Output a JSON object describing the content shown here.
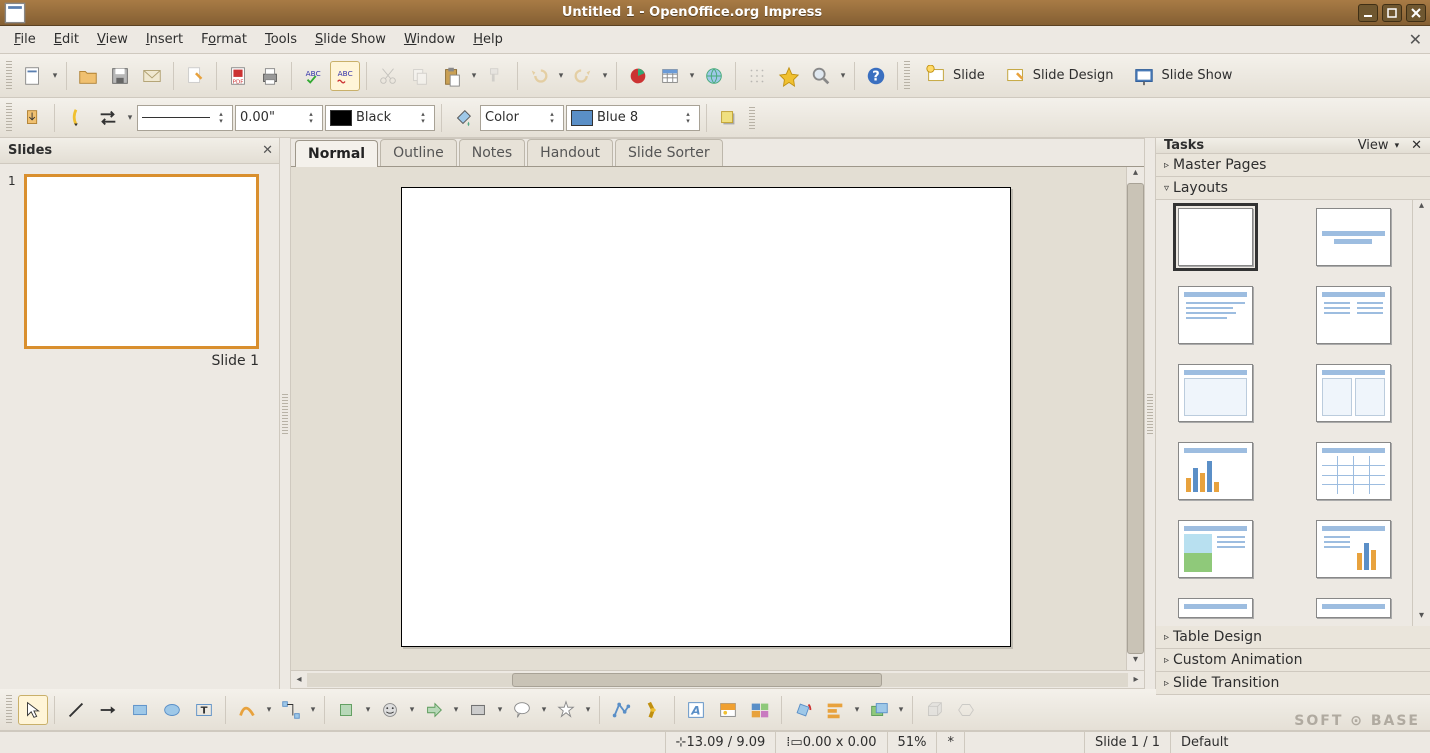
{
  "titlebar": {
    "title": "Untitled 1 - OpenOffice.org Impress"
  },
  "menubar": {
    "items": [
      "File",
      "Edit",
      "View",
      "Insert",
      "Format",
      "Tools",
      "Slide Show",
      "Window",
      "Help"
    ]
  },
  "toolbar_right": {
    "slide": "Slide",
    "slide_design": "Slide Design",
    "slide_show": "Slide Show"
  },
  "toolbar2": {
    "line_width": "0.00\"",
    "fill_label": "Black",
    "fill_mode": "Color",
    "fill_color": "Blue 8"
  },
  "slides_panel": {
    "title": "Slides",
    "thumb_number": "1",
    "thumb_label": "Slide 1"
  },
  "viewtabs": [
    "Normal",
    "Outline",
    "Notes",
    "Handout",
    "Slide Sorter"
  ],
  "tasks_panel": {
    "title": "Tasks",
    "view_label": "View",
    "sections": {
      "master_pages": "Master Pages",
      "layouts": "Layouts",
      "table_design": "Table Design",
      "custom_animation": "Custom Animation",
      "slide_transition": "Slide Transition"
    }
  },
  "statusbar": {
    "pos": "13.09 / 9.09",
    "size": "0.00 x 0.00",
    "zoom": "51%",
    "modified": "*",
    "slide": "Slide 1 / 1",
    "template": "Default"
  },
  "watermark": "SOFT ⊙ BASE"
}
